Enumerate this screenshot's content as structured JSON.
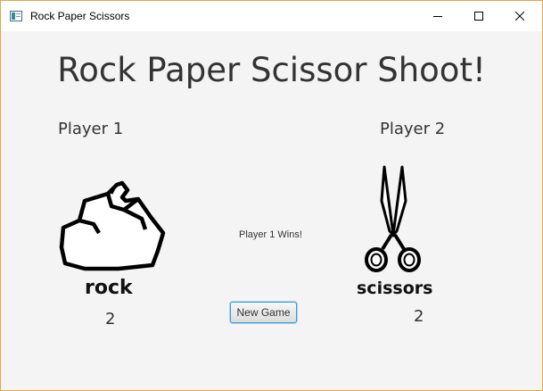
{
  "window": {
    "title": "Rock Paper Scissors",
    "accent_border": "#e8a44a",
    "icons": [
      "app-icon",
      "minimize-icon",
      "maximize-icon",
      "close-icon"
    ]
  },
  "game": {
    "heading": "Rock Paper Scissor Shoot!",
    "result": "Player 1 Wins!",
    "new_game_label": "New Game",
    "player1": {
      "label": "Player 1",
      "choice": "rock",
      "choice_icon": "rock-icon",
      "score": "2"
    },
    "player2": {
      "label": "Player 2",
      "choice": "scissors",
      "choice_icon": "scissors-icon",
      "score": "2"
    }
  }
}
